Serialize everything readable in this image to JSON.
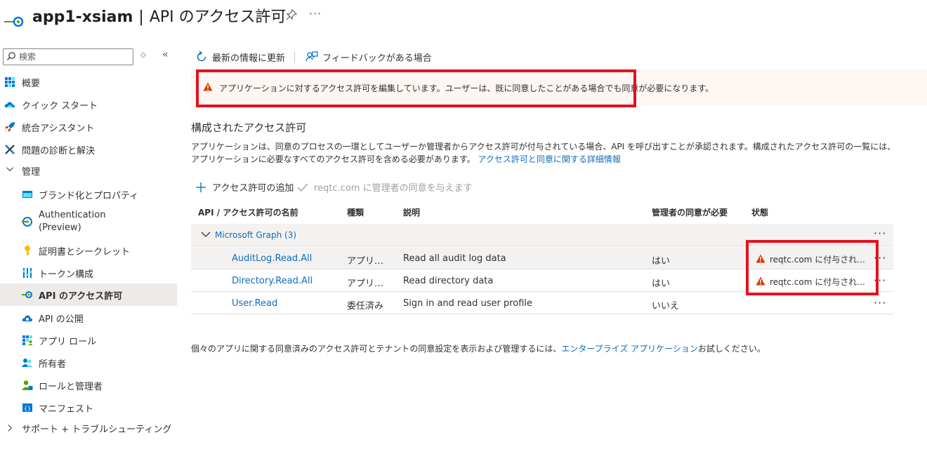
{
  "header": {
    "app_name": "app1-xsiam",
    "separator": "|",
    "page_title": "API のアクセス許可",
    "more": "···"
  },
  "sidebar": {
    "search_placeholder": "検索",
    "updown": "◇",
    "collapse": "«",
    "items": [
      {
        "label": "概要",
        "icon": "overview-icon"
      },
      {
        "label": "クイック スタート",
        "icon": "cloud-icon"
      },
      {
        "label": "統合アシスタント",
        "icon": "rocket-icon"
      },
      {
        "label": "問題の診断と解決",
        "icon": "wrench-icon"
      },
      {
        "label": "管理",
        "icon": "chevron-down-icon"
      },
      {
        "label": "ブランド化とプロパティ",
        "icon": "branding-icon"
      },
      {
        "label": "Authentication",
        "label2": "(Preview)",
        "icon": "authentication-icon"
      },
      {
        "label": "証明書とシークレット",
        "icon": "key-icon"
      },
      {
        "label": "トークン構成",
        "icon": "token-icon"
      },
      {
        "label": "API のアクセス許可",
        "icon": "api-permissions-icon"
      },
      {
        "label": "API の公開",
        "icon": "expose-api-icon"
      },
      {
        "label": "アプリ ロール",
        "icon": "app-roles-icon"
      },
      {
        "label": "所有者",
        "icon": "owners-icon"
      },
      {
        "label": "ロールと管理者",
        "icon": "roles-admins-icon"
      },
      {
        "label": "マニフェスト",
        "icon": "manifest-icon"
      },
      {
        "label": "サポート + トラブルシューティング",
        "icon": "chevron-right-icon"
      }
    ]
  },
  "toolbar": {
    "refresh": "最新の情報に更新",
    "feedback": "フィードバックがある場合"
  },
  "banner": {
    "text": "アプリケーションに対するアクセス許可を編集しています。ユーザーは、既に同意したことがある場合でも同意が必要になります。"
  },
  "section": {
    "title": "構成されたアクセス許可",
    "description": "アプリケーションは、同意のプロセスの一環としてユーザーか管理者からアクセス許可が付与されている場合、API を呼び出すことが承認されます。構成されたアクセス許可の一覧には、アプリケーションに必要なすべてのアクセス許可を含める必要があります。",
    "link": "アクセス許可と同意に関する詳細情報"
  },
  "commands": {
    "add": "アクセス許可の追加",
    "grant": "reqtc.com に管理者の同意を与えます"
  },
  "table": {
    "headers": {
      "name": "API / アクセス許可の名前",
      "type": "種類",
      "description": "説明",
      "admin_consent": "管理者の同意が必要",
      "status": "状態"
    },
    "group": "Microsoft Graph (3)",
    "rows": [
      {
        "name": "AuditLog.Read.All",
        "type": "アプリケーション",
        "description": "Read all audit log data",
        "admin": "はい",
        "status": "reqtc.com に付与されていません"
      },
      {
        "name": "Directory.Read.All",
        "type": "アプリケーション",
        "description": "Read directory data",
        "admin": "はい",
        "status": "reqtc.com に付与されていません"
      },
      {
        "name": "User.Read",
        "type": "委任済み",
        "description": "Sign in and read user profile",
        "admin": "いいえ",
        "status": ""
      }
    ],
    "row_more": "···"
  },
  "footer": {
    "prefix": "個々のアプリに関する同意済みのアクセス許可とテナントの同意設定を表示および管理するには、",
    "link": "エンタープライズ アプリケーション",
    "suffix": "お試しください。"
  },
  "colors": {
    "accent": "#0f6cbd",
    "warning": "#d83b01",
    "highlight_box": "#e3121f",
    "banner_bg": "#fdf6f3"
  }
}
